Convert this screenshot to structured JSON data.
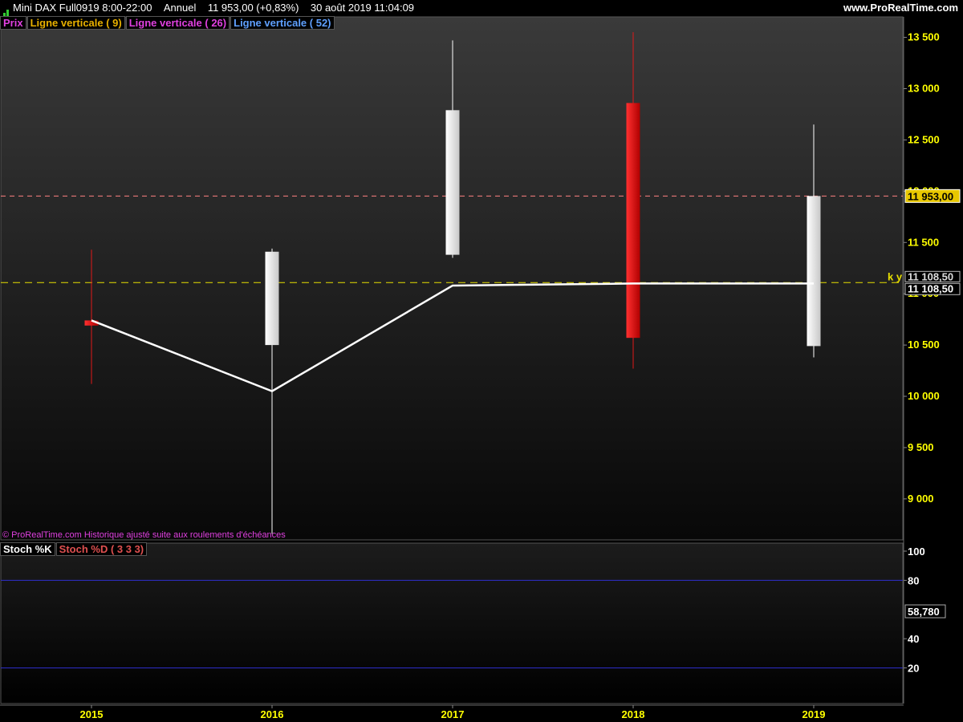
{
  "header": {
    "instrument": "Mini DAX Full0919 8:00-22:00",
    "period": "Annuel",
    "last_quote": "11 953,00 (+0,83%)",
    "datetime": "30 août 2019 11:04:09",
    "site": "www.ProRealTime.com"
  },
  "legend": {
    "price": "Prix",
    "ma9": "Ligne verticale ( 9)",
    "ma26": "Ligne verticale ( 26)",
    "ma52": "Ligne verticale ( 52)"
  },
  "notice": "© ProRealTime.com Historique ajusté suite aux roulements d'échéances",
  "stoch_legend": {
    "k": "Stoch %K",
    "d": "Stoch %D ( 3 3 3)"
  },
  "colors": {
    "up": "#ffffff",
    "down": "#e01818",
    "price_line": "#ff8080",
    "ky_line": "#e8e000",
    "axis_text": "#ffff00",
    "stoch_band": "#3030d0"
  },
  "chart_data": [
    {
      "type": "candlestick",
      "x": [
        "2015",
        "2016",
        "2017",
        "2018",
        "2019"
      ],
      "series": [
        {
          "open": [
            10740,
            10500,
            11380,
            12860,
            10490
          ],
          "high": [
            11430,
            11440,
            13470,
            13550,
            12650
          ],
          "low": [
            10120,
            8660,
            11350,
            10270,
            10380
          ],
          "close": [
            10690,
            11410,
            12790,
            10570,
            11953
          ]
        },
        {
          "name": "Ligne verticale ( 9)",
          "values": [
            10740,
            10050,
            11080,
            11100,
            11100
          ]
        }
      ],
      "ylim": [
        8600,
        13700
      ],
      "yticks": [
        9000,
        9500,
        10000,
        10500,
        11000,
        11500,
        12000,
        12500,
        13000,
        13500
      ],
      "ytick_labels": [
        "9 000",
        "9 500",
        "10 000",
        "10 500",
        "11 000",
        "11 500",
        "12 000",
        "12 500",
        "13 000",
        "13 500"
      ],
      "current_price": 11953,
      "current_price_label": "11 953,00",
      "ky_level": 11108.5,
      "ky_label": "k y",
      "ky_value_labels": [
        "11 108,50",
        "11 108,50"
      ]
    },
    {
      "type": "line",
      "ylim": [
        0,
        100
      ],
      "yticks": [
        100,
        80,
        40,
        20
      ],
      "ytick_labels": [
        "100",
        "80",
        "40",
        "20"
      ],
      "band_levels": [
        20,
        80
      ],
      "current_value": 58.78,
      "current_value_label": "58,780"
    }
  ]
}
